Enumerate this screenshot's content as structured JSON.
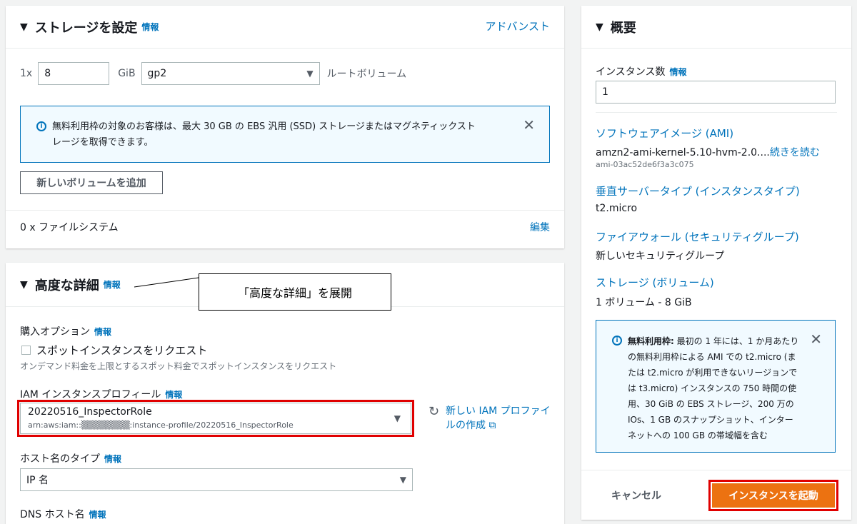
{
  "storage": {
    "title": "ストレージを設定",
    "info": "情報",
    "advanced_link": "アドバンスト",
    "qty_prefix": "1x",
    "size_value": "8",
    "unit": "GiB",
    "volume_type": "gp2",
    "volume_label": "ルートボリューム",
    "notice_line1": "無料利用枠の対象のお客様は、最大 30 GB の EBS 汎用 (SSD) ストレージまたはマグネティックスト",
    "notice_line2": "レージを取得できます。",
    "add_volume_button": "新しいボリュームを追加",
    "filesystem_text": "0 x ファイルシステム",
    "edit_link": "編集"
  },
  "advanced": {
    "title": "高度な詳細",
    "info": "情報",
    "callout_text": "「高度な詳細」を展開",
    "purchase_label": "購入オプション",
    "spot_checkbox_label": "スポットインスタンスをリクエスト",
    "spot_description": "オンデマンド料金を上限とするスポット料金でスポットインスタンスをリクエスト",
    "iam_label": "IAM インスタンスプロフィール",
    "iam_value": "20220516_InspectorRole",
    "iam_arn": "arn:aws:iam::▒▒▒▒▒▒▒▒:instance-profile/20220516_InspectorRole",
    "new_iam_line1": "新しい IAM プロファイ",
    "new_iam_line2": "ルの作成",
    "hostname_type_label": "ホスト名のタイプ",
    "hostname_type_value": "IP 名",
    "dns_hostname_label": "DNS ホスト名"
  },
  "summary": {
    "title": "概要",
    "instance_count_label": "インスタンス数",
    "info": "情報",
    "instance_count_value": "1",
    "ami_link": "ソフトウェアイメージ (AMI)",
    "ami_name": "amzn2-ami-kernel-5.10-hvm-2.0....",
    "read_more": "続きを読む",
    "ami_id": "ami-03ac52de6f3a3c075",
    "instance_type_link": "垂直サーバータイプ (インスタンスタイプ)",
    "instance_type_value": "t2.micro",
    "firewall_link": "ファイアウォール (セキュリティグループ)",
    "firewall_value": "新しいセキュリティグループ",
    "storage_link": "ストレージ (ボリューム)",
    "storage_value": "1 ボリューム - 8 GiB",
    "free_tier_bold": "無料利用枠:",
    "free_tier_lines": [
      "最初の 1 年には、1 か月あたり",
      "の無料利用枠による AMI での t2.micro (ま",
      "たは t2.micro が利用できないリージョンで",
      "は t3.micro) インスタンスの 750 時間の使",
      "用、30 GiB の EBS ストレージ、200 万の",
      "IOs、1 GB のスナップショット、インター",
      "ネットへの 100 GB の帯域幅を含む"
    ],
    "cancel_button": "キャンセル",
    "launch_button": "インスタンスを起動"
  },
  "colors": {
    "link": "#0073bb",
    "launch": "#ec7211",
    "highlight": "#e00000",
    "background": "#f2f3f3"
  }
}
